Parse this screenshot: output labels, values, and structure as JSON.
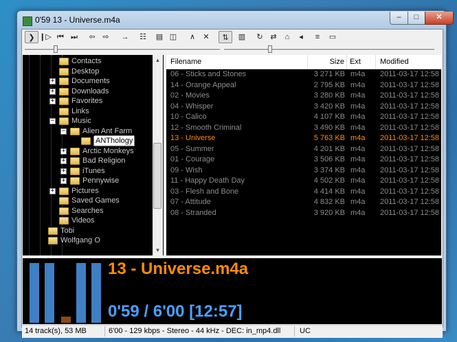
{
  "window": {
    "title": "0'59 13 - Universe.m4a",
    "min_icon": "minimize-icon",
    "max_icon": "maximize-icon",
    "close_icon": "close-icon",
    "min_glyph": "–",
    "max_glyph": "□",
    "close_glyph": "✕"
  },
  "toolbar": {
    "buttons": [
      {
        "name": "play-icon",
        "glyph": "❯",
        "active": true
      },
      {
        "name": "pause-icon",
        "glyph": "❙▷"
      },
      {
        "name": "previous-icon",
        "glyph": "⏮"
      },
      {
        "name": "next-icon",
        "glyph": "⏭"
      },
      {
        "name": "back-folder-icon",
        "glyph": "⇦"
      },
      {
        "name": "forward-folder-icon",
        "glyph": "⇨"
      },
      {
        "name": "jump-icon",
        "glyph": "→"
      },
      {
        "name": "equalizer-icon",
        "glyph": "☷"
      },
      {
        "name": "minimize-view-icon",
        "glyph": "▤"
      },
      {
        "name": "panel-icon",
        "glyph": "◫"
      },
      {
        "name": "up-icon",
        "glyph": "∧"
      },
      {
        "name": "remove-icon",
        "glyph": "✕"
      },
      {
        "name": "sort-icon",
        "glyph": "⇅",
        "active": true
      },
      {
        "name": "layout-icon",
        "glyph": "▥"
      },
      {
        "name": "repeat-icon",
        "glyph": "↻"
      },
      {
        "name": "shuffle-icon",
        "glyph": "⇄"
      },
      {
        "name": "home-icon",
        "glyph": "⌂"
      },
      {
        "name": "volume-icon",
        "glyph": "◂"
      },
      {
        "name": "library-icon",
        "glyph": "≡"
      },
      {
        "name": "settings-icon",
        "glyph": "▭"
      }
    ]
  },
  "sliders": {
    "position_fraction": 0.16,
    "volume_fraction": 0.22
  },
  "tree": {
    "nodes": [
      {
        "label": "Contacts",
        "level": 3,
        "expander": ""
      },
      {
        "label": "Desktop",
        "level": 3,
        "expander": ""
      },
      {
        "label": "Documents",
        "level": 3,
        "expander": "+"
      },
      {
        "label": "Downloads",
        "level": 3,
        "expander": "+"
      },
      {
        "label": "Favorites",
        "level": 3,
        "expander": "+"
      },
      {
        "label": "Links",
        "level": 3,
        "expander": ""
      },
      {
        "label": "Music",
        "level": 3,
        "expander": "−"
      },
      {
        "label": "Alien Ant Farm",
        "level": 4,
        "expander": "−"
      },
      {
        "label": "ANThology",
        "level": 5,
        "expander": "",
        "selected": true
      },
      {
        "label": "Arctic Monkeys",
        "level": 4,
        "expander": "+"
      },
      {
        "label": "Bad Religion",
        "level": 4,
        "expander": "+"
      },
      {
        "label": "iTunes",
        "level": 4,
        "expander": "+"
      },
      {
        "label": "Pennywise",
        "level": 4,
        "expander": "+"
      },
      {
        "label": "Pictures",
        "level": 3,
        "expander": "+"
      },
      {
        "label": "Saved Games",
        "level": 3,
        "expander": ""
      },
      {
        "label": "Searches",
        "level": 3,
        "expander": ""
      },
      {
        "label": "Videos",
        "level": 3,
        "expander": ""
      },
      {
        "label": "Tobi",
        "level": 2,
        "expander": ""
      },
      {
        "label": "Wolfgang O",
        "level": 2,
        "expander": ""
      }
    ]
  },
  "list": {
    "columns": {
      "filename": "Filename",
      "size": "Size",
      "ext": "Ext",
      "modified": "Modified"
    },
    "rows": [
      {
        "filename": "06 - Sticks and Stones",
        "size": "3 271 KB",
        "ext": "m4a",
        "modified": "2011-03-17 12:58"
      },
      {
        "filename": "14 - Orange Appeal",
        "size": "2 795 KB",
        "ext": "m4a",
        "modified": "2011-03-17 12:58"
      },
      {
        "filename": "02 - Movies",
        "size": "3 280 KB",
        "ext": "m4a",
        "modified": "2011-03-17 12:58"
      },
      {
        "filename": "04 - Whisper",
        "size": "3 420 KB",
        "ext": "m4a",
        "modified": "2011-03-17 12:58"
      },
      {
        "filename": "10 - Calico",
        "size": "4 107 KB",
        "ext": "m4a",
        "modified": "2011-03-17 12:58"
      },
      {
        "filename": "12 - Smooth Criminal",
        "size": "3 490 KB",
        "ext": "m4a",
        "modified": "2011-03-17 12:58"
      },
      {
        "filename": "13 - Universe",
        "size": "5 763 KB",
        "ext": "m4a",
        "modified": "2011-03-17 12:58",
        "playing": true
      },
      {
        "filename": "05 - Summer",
        "size": "4 201 KB",
        "ext": "m4a",
        "modified": "2011-03-17 12:58"
      },
      {
        "filename": "01 - Courage",
        "size": "3 506 KB",
        "ext": "m4a",
        "modified": "2011-03-17 12:58"
      },
      {
        "filename": "09 - Wish",
        "size": "3 374 KB",
        "ext": "m4a",
        "modified": "2011-03-17 12:58"
      },
      {
        "filename": "11 - Happy Death Day",
        "size": "4 502 KB",
        "ext": "m4a",
        "modified": "2011-03-17 12:58"
      },
      {
        "filename": "03 - Flesh and Bone",
        "size": "4 414 KB",
        "ext": "m4a",
        "modified": "2011-03-17 12:58"
      },
      {
        "filename": "07 - Attitude",
        "size": "4 832 KB",
        "ext": "m4a",
        "modified": "2011-03-17 12:58"
      },
      {
        "filename": "08 - Stranded",
        "size": "3 920 KB",
        "ext": "m4a",
        "modified": "2011-03-17 12:58"
      }
    ]
  },
  "visualizer": {
    "levels": [
      0.95,
      0.95,
      0.1,
      0.95,
      0.95
    ],
    "low_index": 2,
    "colors": {
      "bar": "#3f7fc4",
      "low": "#8b4a14"
    },
    "now_playing": "13 - Universe.m4a",
    "time": "0'59 / 6'00   [12:57]"
  },
  "status": {
    "tracks": "14 track(s), 53 MB",
    "info": "6'00 - 129 kbps - Stereo - 44 kHz - DEC: in_mp4.dll",
    "mode": "UC"
  },
  "colors": {
    "playing": "#ff8c00",
    "time": "#4aa0ff",
    "row": "#8c8c8c"
  }
}
